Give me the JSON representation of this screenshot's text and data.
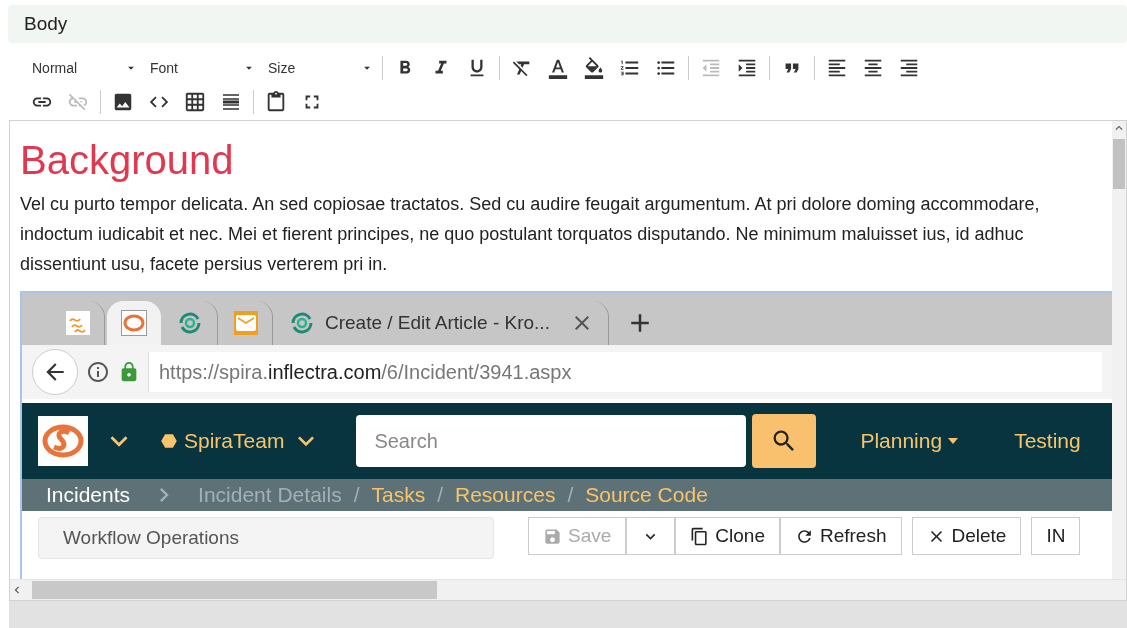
{
  "field_label": "Body",
  "toolbar": {
    "rows": [
      [
        {
          "items": [
            {
              "kind": "dropdown",
              "label": "Normal",
              "disabled": false
            },
            {
              "kind": "dropdown",
              "label": "Font",
              "disabled": false
            },
            {
              "kind": "dropdown",
              "label": "Size",
              "disabled": false
            }
          ]
        },
        {
          "items": [
            {
              "kind": "bold",
              "disabled": false
            },
            {
              "kind": "italic",
              "disabled": false
            },
            {
              "kind": "underline",
              "disabled": false
            }
          ]
        },
        {
          "items": [
            {
              "kind": "clear-format",
              "disabled": false
            },
            {
              "kind": "text-color",
              "disabled": false
            },
            {
              "kind": "background-color",
              "disabled": false
            },
            {
              "kind": "numbered-list",
              "disabled": false
            },
            {
              "kind": "bulleted-list",
              "disabled": false
            }
          ]
        },
        {
          "items": [
            {
              "kind": "outdent",
              "disabled": true
            },
            {
              "kind": "indent",
              "disabled": false
            }
          ]
        },
        {
          "items": [
            {
              "kind": "quote",
              "disabled": false
            }
          ]
        },
        {
          "items": [
            {
              "kind": "align-left",
              "disabled": false
            },
            {
              "kind": "align-center",
              "disabled": false
            },
            {
              "kind": "align-right",
              "disabled": false
            }
          ]
        }
      ],
      [
        {
          "items": [
            {
              "kind": "link",
              "disabled": false
            },
            {
              "kind": "unlink",
              "disabled": true
            }
          ]
        },
        {
          "items": [
            {
              "kind": "image",
              "disabled": false
            },
            {
              "kind": "code-snippet",
              "disabled": false
            },
            {
              "kind": "table",
              "disabled": false
            },
            {
              "kind": "horizontal-rule",
              "disabled": false
            }
          ]
        },
        {
          "items": [
            {
              "kind": "paste-word",
              "disabled": false
            },
            {
              "kind": "maximize",
              "disabled": false
            }
          ]
        }
      ]
    ]
  },
  "editor": {
    "heading": "Background",
    "paragraph": "Vel cu purto tempor delicata. An sed copiosae tractatos. Sed cu audire feugait argumentum. At pri dolore doming accommodare, indoctum iudicabit et nec. Mei et fierent principes, ne quo postulant torquatos disputando. Ne minimum maluisset ius, id adhuc dissentiunt usu, facete persius verterem pri in.",
    "screenshot": {
      "tabs": [
        {
          "kind": "pinned",
          "selected": false
        },
        {
          "kind": "pinned",
          "selected": true
        },
        {
          "kind": "pinned",
          "selected": false
        },
        {
          "kind": "pinned",
          "selected": false
        },
        {
          "kind": "titled",
          "title": "Create / Edit Article - Kro...",
          "selected": false
        }
      ],
      "url": {
        "prefix": "https://spira.",
        "domain": "inflectra.com",
        "path": "/6/Incident/3941.aspx"
      },
      "app": {
        "project": "SpiraTeam",
        "search_placeholder": "Search",
        "menus": [
          "Planning",
          "Testing"
        ],
        "breadcrumb": [
          {
            "label": "Incidents",
            "kind": "section"
          },
          {
            "label": "Incident Details",
            "kind": "current"
          },
          {
            "label": "Tasks",
            "kind": "link",
            "separator": "/"
          },
          {
            "label": "Resources",
            "kind": "link",
            "separator": "/"
          },
          {
            "label": "Source Code",
            "kind": "link",
            "separator": "/"
          }
        ],
        "panel_title": "Workflow Operations",
        "buttons": [
          {
            "kind": "save",
            "label": "Save",
            "disabled": true
          },
          {
            "kind": "menu",
            "disabled": false
          },
          {
            "kind": "clone",
            "label": "Clone",
            "disabled": false
          },
          {
            "kind": "refresh",
            "label": "Refresh",
            "disabled": false
          },
          {
            "kind": "delete",
            "label": "Delete",
            "disabled": false
          },
          {
            "kind": "plain",
            "label": "IN",
            "disabled": false
          }
        ]
      }
    }
  }
}
